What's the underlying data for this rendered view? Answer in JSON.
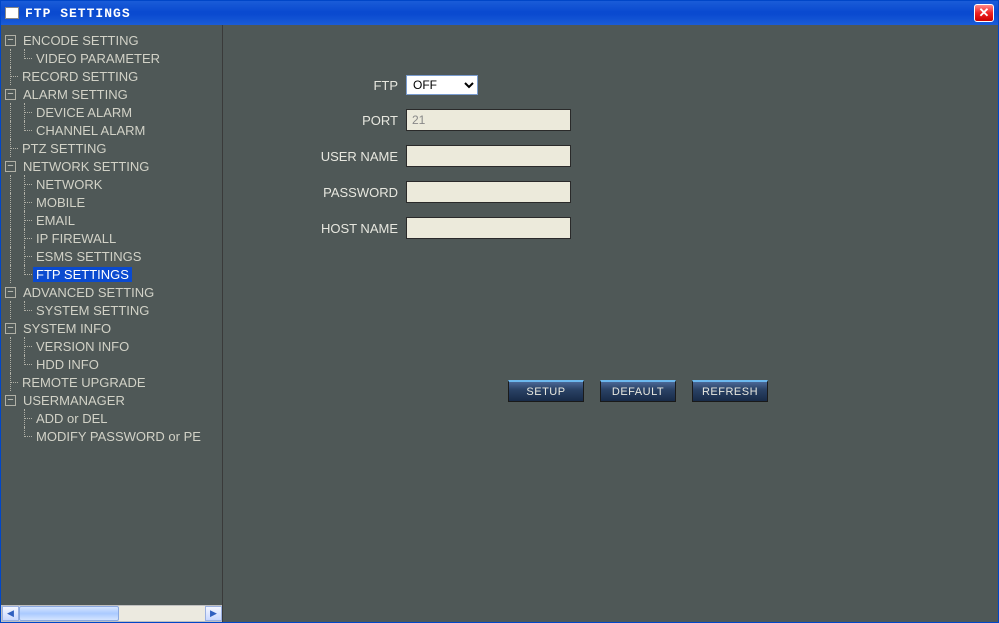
{
  "window": {
    "title": "FTP SETTINGS"
  },
  "tree": {
    "encode_setting": "ENCODE SETTING",
    "video_parameter": "VIDEO PARAMETER",
    "record_setting": "RECORD SETTING",
    "alarm_setting": "ALARM SETTING",
    "device_alarm": "DEVICE ALARM",
    "channel_alarm": "CHANNEL ALARM",
    "ptz_setting": "PTZ SETTING",
    "network_setting": "NETWORK SETTING",
    "network": "NETWORK",
    "mobile": "MOBILE",
    "email": "EMAIL",
    "ip_firewall": "IP FIREWALL",
    "esms_settings": "ESMS SETTINGS",
    "ftp_settings": "FTP SETTINGS",
    "advanced_setting": "ADVANCED SETTING",
    "system_setting": "SYSTEM SETTING",
    "system_info": "SYSTEM INFO",
    "version_info": "VERSION INFO",
    "hdd_info": "HDD INFO",
    "remote_upgrade": "REMOTE UPGRADE",
    "usermanager": "USERMANAGER",
    "add_or_del": "ADD or DEL",
    "modify_password": "MODIFY PASSWORD or PE"
  },
  "form": {
    "ftp_label": "FTP",
    "ftp_value": "OFF",
    "port_label": "PORT",
    "port_value": "21",
    "username_label": "USER NAME",
    "username_value": "",
    "password_label": "PASSWORD",
    "password_value": "",
    "hostname_label": "HOST NAME",
    "hostname_value": ""
  },
  "buttons": {
    "setup": "SETUP",
    "default": "DEFAULT",
    "refresh": "REFRESH"
  }
}
